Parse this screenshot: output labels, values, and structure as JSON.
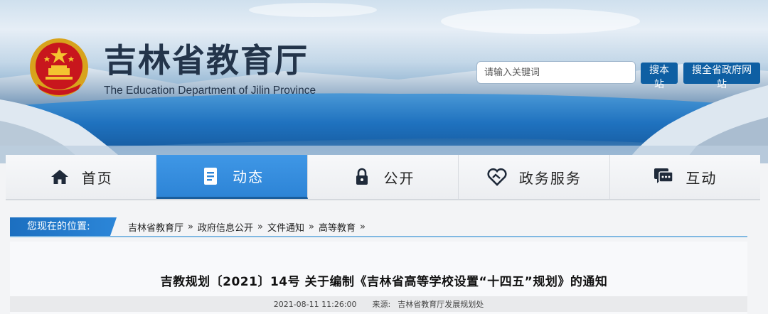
{
  "header": {
    "title": "吉林省教育厅",
    "subtitle": "The Education Department of Jilin Province",
    "emblem_icon": "national-emblem-icon"
  },
  "search": {
    "placeholder": "请输入关键词",
    "value": "",
    "search_site_label": "搜本站",
    "search_all_label": "搜全省政府网站"
  },
  "nav": {
    "items": [
      {
        "label": "首页",
        "icon": "home-icon",
        "active": false
      },
      {
        "label": "动态",
        "icon": "document-icon",
        "active": true
      },
      {
        "label": "公开",
        "icon": "lock-icon",
        "active": false
      },
      {
        "label": "政务服务",
        "icon": "handshake-heart-icon",
        "active": false
      },
      {
        "label": "互动",
        "icon": "chat-icon",
        "active": false
      }
    ]
  },
  "breadcrumb": {
    "label": "您现在的位置:",
    "items": [
      "吉林省教育厅",
      "政府信息公开",
      "文件通知",
      "高等教育"
    ],
    "separator": "»"
  },
  "article": {
    "title": "吉教规划〔2021〕14号 关于编制《吉林省高等学校设置“十四五”规划》的通知",
    "date": "2021-08-11 11:26:00",
    "source_label": "来源:",
    "source": "吉林省教育厅发展规划处"
  },
  "colors": {
    "brand_blue": "#0e5fa3",
    "nav_active": "#2d84d6",
    "title_text": "#23344a"
  }
}
